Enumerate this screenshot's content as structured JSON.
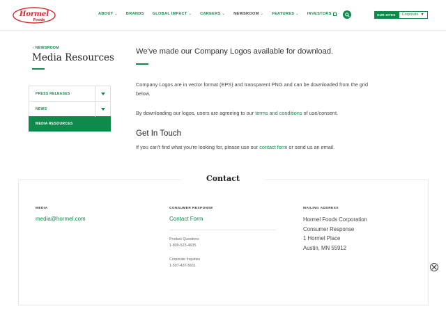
{
  "header": {
    "logo_text": "Hormel Foods",
    "nav": [
      {
        "label": "ABOUT",
        "dropdown": true
      },
      {
        "label": "BRANDS",
        "dropdown": false
      },
      {
        "label": "GLOBAL IMPACT",
        "dropdown": true
      },
      {
        "label": "CAREERS",
        "dropdown": true
      },
      {
        "label": "NEWSROOM",
        "dropdown": true,
        "active": true
      },
      {
        "label": "FEATURES",
        "dropdown": true
      },
      {
        "label": "INVESTORS",
        "external": true
      }
    ],
    "search_icon": "search-icon",
    "our_sites_label": "OUR SITES",
    "our_sites_value": "Corporate"
  },
  "sidebar": {
    "breadcrumb": "‹ NEWSROOM",
    "title": "Media Resources",
    "items": [
      {
        "label": "PRESS RELEASES",
        "expandable": true
      },
      {
        "label": "NEWS",
        "expandable": true
      },
      {
        "label": "MEDIA RESOURCES",
        "active": true
      }
    ]
  },
  "main": {
    "headline": "We've made our Company Logos available for download.",
    "para1": "Company Logos are in vector format (EPS) and transparent PNG and can be downloaded from the grid below.",
    "para2_before": "By downloading our logos, users are agreeing to our ",
    "para2_link": "terms and conditions",
    "para2_after": " of use/consent.",
    "get_in_touch": "Get In Touch",
    "para3_before": "If you can't find what you're looking for, please use our ",
    "para3_link": "contact form",
    "para3_after": " or send us an email."
  },
  "contact": {
    "title": "Contact",
    "media": {
      "heading": "MEDIA",
      "email": "media@hormel.com"
    },
    "consumer": {
      "heading": "CONSUMER RESPONSE",
      "link": "Contact Form",
      "product_label": "Product Questions",
      "product_phone": "1-800-523-4635",
      "corporate_label": "Corporate Inquiries",
      "corporate_phone": "1-507-437-5611"
    },
    "mailing": {
      "heading": "MAILING ADDRESS",
      "line1": "Hormel Foods Corporation",
      "line2": "Consumer Response",
      "line3": "1 Hormel Place",
      "line4": "Austin, MN 55912"
    }
  },
  "colors": {
    "brand_green": "#0f8a4a",
    "logo_red": "#d8262e"
  }
}
